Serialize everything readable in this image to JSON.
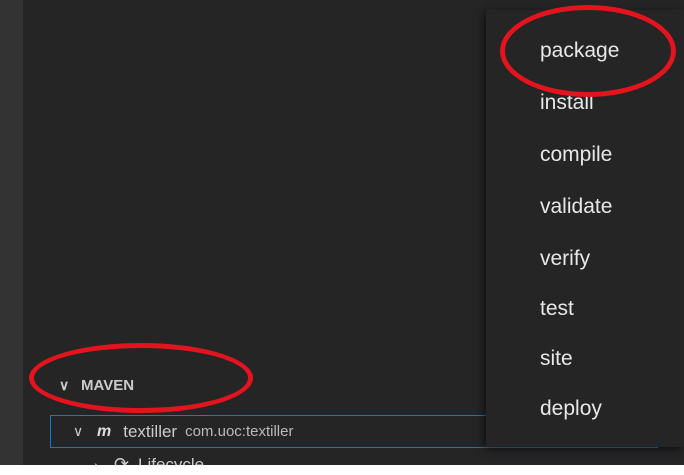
{
  "menu": {
    "items": [
      {
        "label": "package"
      },
      {
        "label": "install"
      },
      {
        "label": "compile"
      },
      {
        "label": "validate"
      },
      {
        "label": "verify"
      },
      {
        "label": "test"
      },
      {
        "label": "site"
      },
      {
        "label": "deploy"
      }
    ]
  },
  "maven_panel": {
    "title": "MAVEN",
    "project": {
      "name": "textiller",
      "description": "com.uoc:textiller"
    },
    "child": {
      "label": "Lifecycle"
    }
  },
  "icons": {
    "chevron": "chevron-down-icon",
    "maven": "maven-icon",
    "lifecycle": "lifecycle-icon"
  },
  "colors": {
    "annotation": "#e3141e",
    "focus_border": "#007fd4",
    "background": "#252526"
  }
}
